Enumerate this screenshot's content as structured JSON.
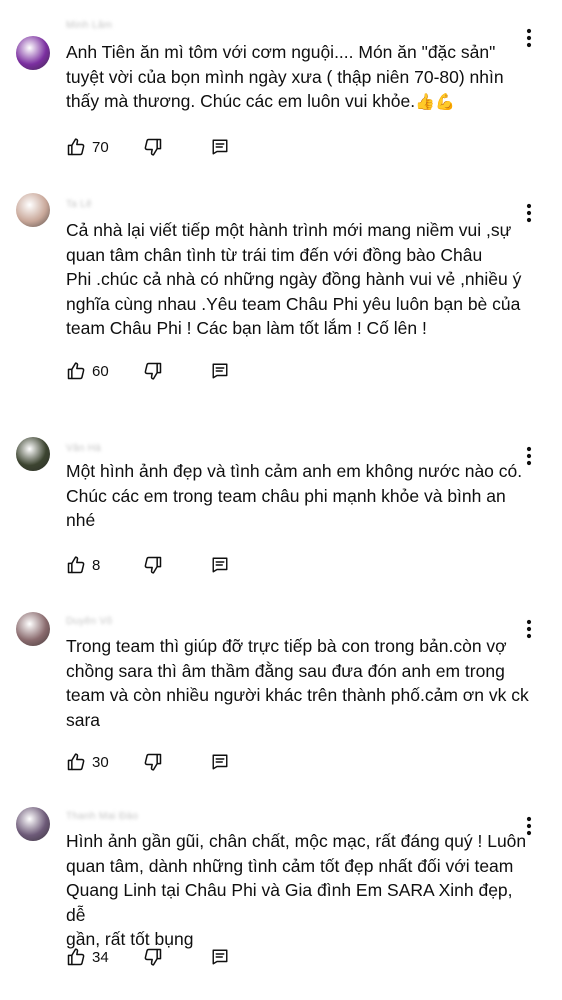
{
  "comments": [
    {
      "author": "Minh Lâm",
      "text": "Anh Tiên ăn mì tôm với cơm nguội.... Món ăn \"đặc sản\"\ntuyệt vời của bọn mình ngày xưa ( thập niên 70-80) nhìn\nthấy mà thương. Chúc các em luôn vui khỏe.",
      "emoji": "👍💪",
      "likes": "70",
      "avatar_color": "#7b2fa0"
    },
    {
      "author": "Ta Lê",
      "text": "Cả nhà lại viết tiếp một hành trình mới mang niềm vui ,sự\nquan tâm chân tình từ trái tim đến với đồng bào Châu\nPhi .chúc cả nhà có những ngày đồng hành vui vẻ ,nhiều ý\nnghĩa cùng nhau .Yêu team Châu Phi yêu luôn bạn bè của\nteam Châu Phi ! Các bạn làm tốt lắm ! Cố lên !",
      "emoji": "",
      "likes": "60",
      "avatar_color": "#c9a89a"
    },
    {
      "author": "Vân Hà",
      "text": "Một hình ảnh đẹp và tình cảm anh em không nước nào có.\nChúc các em trong team châu phi mạnh khỏe và bình an\nnhé",
      "emoji": "",
      "likes": "8",
      "avatar_color": "#3c4430"
    },
    {
      "author": "Duyên Võ",
      "text": "Trong team thì giúp đỡ trực tiếp bà con trong bản.còn vợ\nchồng sara thì âm thầm đằng sau đưa đón anh em trong\nteam và còn nhiều người khác trên thành phố.cảm ơn vk ck\nsara",
      "emoji": "",
      "likes": "30",
      "avatar_color": "#8a6b6e"
    },
    {
      "author": "Thanh Mai Đào",
      "text": "Hình ảnh gần gũi, chân chất, mộc mạc, rất đáng quý ! Luôn\nquan tâm, dành những tình cảm tốt đẹp nhất đối với team\nQuang Linh tại Châu Phi và Gia đình Em SARA Xinh đẹp, dễ\ngần, rất tốt bụng",
      "emoji": "",
      "likes": "34",
      "avatar_color": "#6d5a78"
    }
  ]
}
